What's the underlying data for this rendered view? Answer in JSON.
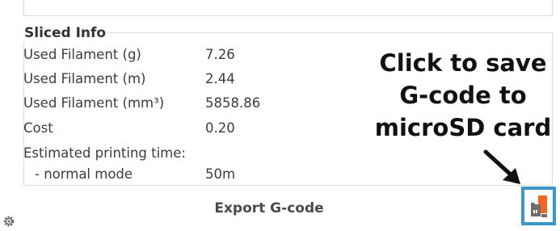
{
  "sliced_info": {
    "title": "Sliced Info",
    "rows": [
      {
        "label": "Used Filament (g)",
        "value": "7.26"
      },
      {
        "label": "Used Filament (m)",
        "value": "2.44"
      },
      {
        "label": "Used Filament (mm³)",
        "value": "5858.86"
      },
      {
        "label": "Cost",
        "value": "0.20"
      },
      {
        "label": "Estimated printing time:",
        "value": ""
      },
      {
        "label": "- normal mode",
        "value": "50m"
      }
    ]
  },
  "export": {
    "label": "Export G-code"
  },
  "callout": {
    "lines": [
      "Click to save",
      "G-code to",
      "microSD card"
    ]
  },
  "icons": {
    "settings": "gear-icon",
    "sd_card": "microsd-card-icon",
    "arrow": "arrow-icon"
  },
  "colors": {
    "sd_button_border": "#3b97c6",
    "sd_card_orange": "#f26522",
    "sd_card_gray": "#6d6d6d"
  }
}
